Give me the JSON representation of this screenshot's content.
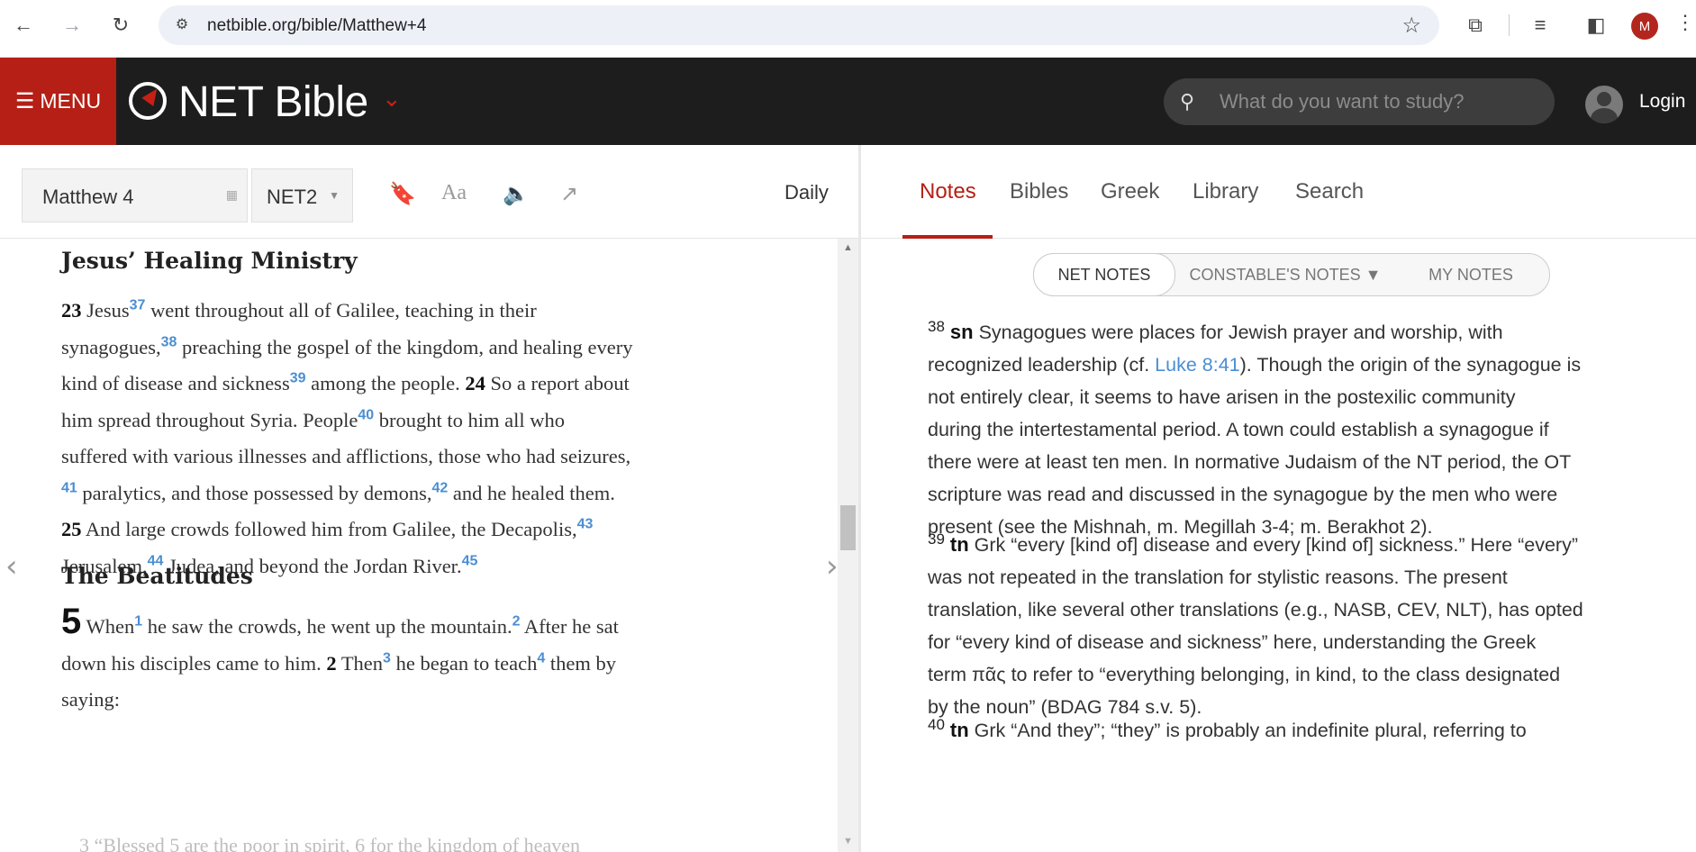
{
  "browser": {
    "url": "netbible.org/bible/Matthew+4",
    "profile_initial": "M"
  },
  "header": {
    "menu_label": "MENU",
    "brand": "NET Bible",
    "search_placeholder": "What do you want to study?",
    "login_label": "Login"
  },
  "toolbar": {
    "passage": "Matthew 4",
    "version": "NET2",
    "font_label": "Aa",
    "daily_label": "Daily"
  },
  "reading": {
    "heading_1": "Jesus’ Healing Ministry",
    "heading_2": "The Beatitudes",
    "fade_text": "3 “Blessed 5 are the poor in spirit, 6 for the kingdom of heaven",
    "lines": [
      {
        "v": "23",
        "t": "Jesus",
        "f": "37",
        "r": " went throughout all of Galilee, teaching in their"
      },
      {
        "t": "synagogues,",
        "f": "38",
        "r": " preaching the gospel of the kingdom, and healing every"
      },
      {
        "t": "kind of disease and sickness",
        "f": "39",
        "r": " among the people.",
        "v2": "24",
        "r2": "So a report about"
      },
      {
        "t": "him spread throughout Syria. People",
        "f": "40",
        "r": " brought to him all who"
      },
      {
        "t": "suffered with various illnesses and afflictions, those who had seizures,"
      },
      {
        "pf": "41",
        "t": " paralytics, and those possessed by demons,",
        "f": "42",
        "r": " and he healed them."
      },
      {
        "v": "25",
        "t": "And large crowds followed him from Galilee, the Decapolis,",
        "f": "43"
      },
      {
        "t": "Jerusalem,",
        "f": "44",
        "r": " Judea, and beyond the Jordan River.",
        "f2": "45"
      }
    ],
    "beatitudes": [
      {
        "chap": "5",
        "t": "When",
        "f": "1",
        "r": " he saw the crowds, he went up the mountain.",
        "f2": "2",
        "r2": " After he sat"
      },
      {
        "t": "down his disciples came to him.",
        "v": "2",
        "t2": "Then",
        "f": "3",
        "r": " he began to teach",
        "f2": "4",
        "r2": " them by"
      },
      {
        "t": "saying:"
      }
    ]
  },
  "tabs": [
    "Notes",
    "Bibles",
    "Greek",
    "Library",
    "Search"
  ],
  "note_switch": [
    "NET NOTES",
    "CONSTABLE'S NOTES ▼",
    "MY NOTES"
  ],
  "notes": [
    {
      "num": "38",
      "type": "sn",
      "lines": [
        "Synagogues were places for Jewish prayer and worship, with",
        "recognized leadership (cf. |Luke 8:41|). Though the origin of the synagogue is",
        "not entirely clear, it seems to have arisen in the postexilic community",
        "during the intertestamental period. A town could establish a synagogue if",
        "there were at least ten men. In normative Judaism of the NT period, the OT",
        "scripture was read and discussed in the synagogue by the men who were",
        "present (see the Mishnah, m. Megillah 3-4; m. Berakhot 2)."
      ]
    },
    {
      "num": "39",
      "type": "tn",
      "lines": [
        "Grk “every [kind of] disease and every [kind of] sickness.” Here “every”",
        "was not repeated in the translation for stylistic reasons. The present",
        "translation, like several other translations (e.g., NASB, CEV, NLT), has opted",
        "for “every kind of disease and sickness” here, understanding the Greek",
        "term πᾶς to refer to “everything belonging, in kind, to the class designated",
        "by the noun” (BDAG 784 s.v. 5)."
      ]
    },
    {
      "num": "40",
      "type": "tn",
      "lines": [
        "Grk “And they”; “they” is probably an indefinite plural, referring to"
      ]
    }
  ]
}
